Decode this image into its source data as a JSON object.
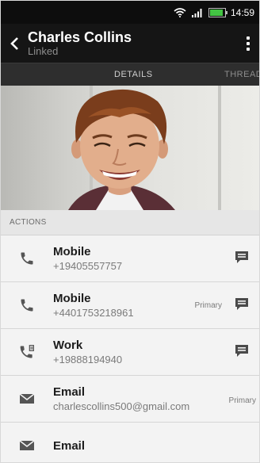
{
  "status": {
    "time": "14:59",
    "battery_level": 0.8
  },
  "header": {
    "name": "Charles Collins",
    "subtitle": "Linked"
  },
  "tabs": [
    {
      "label": "DETAILS"
    },
    {
      "label": "THREADS"
    }
  ],
  "section": {
    "title": "ACTIONS"
  },
  "rows": [
    {
      "label": "Mobile",
      "value": "+19405557757",
      "primary": "",
      "icon": "phone-icon",
      "action_icon": "message-icon"
    },
    {
      "label": "Mobile",
      "value": "+4401753218961",
      "primary": "Primary",
      "icon": "phone-icon",
      "action_icon": "message-icon"
    },
    {
      "label": "Work",
      "value": "+19888194940",
      "primary": "",
      "icon": "work-phone-icon",
      "action_icon": "message-icon"
    },
    {
      "label": "Email",
      "value": "charlescollins500@gmail.com",
      "primary": "Primary",
      "icon": "email-icon"
    },
    {
      "label": "Email",
      "value": "",
      "primary": "",
      "icon": "email-icon"
    }
  ]
}
